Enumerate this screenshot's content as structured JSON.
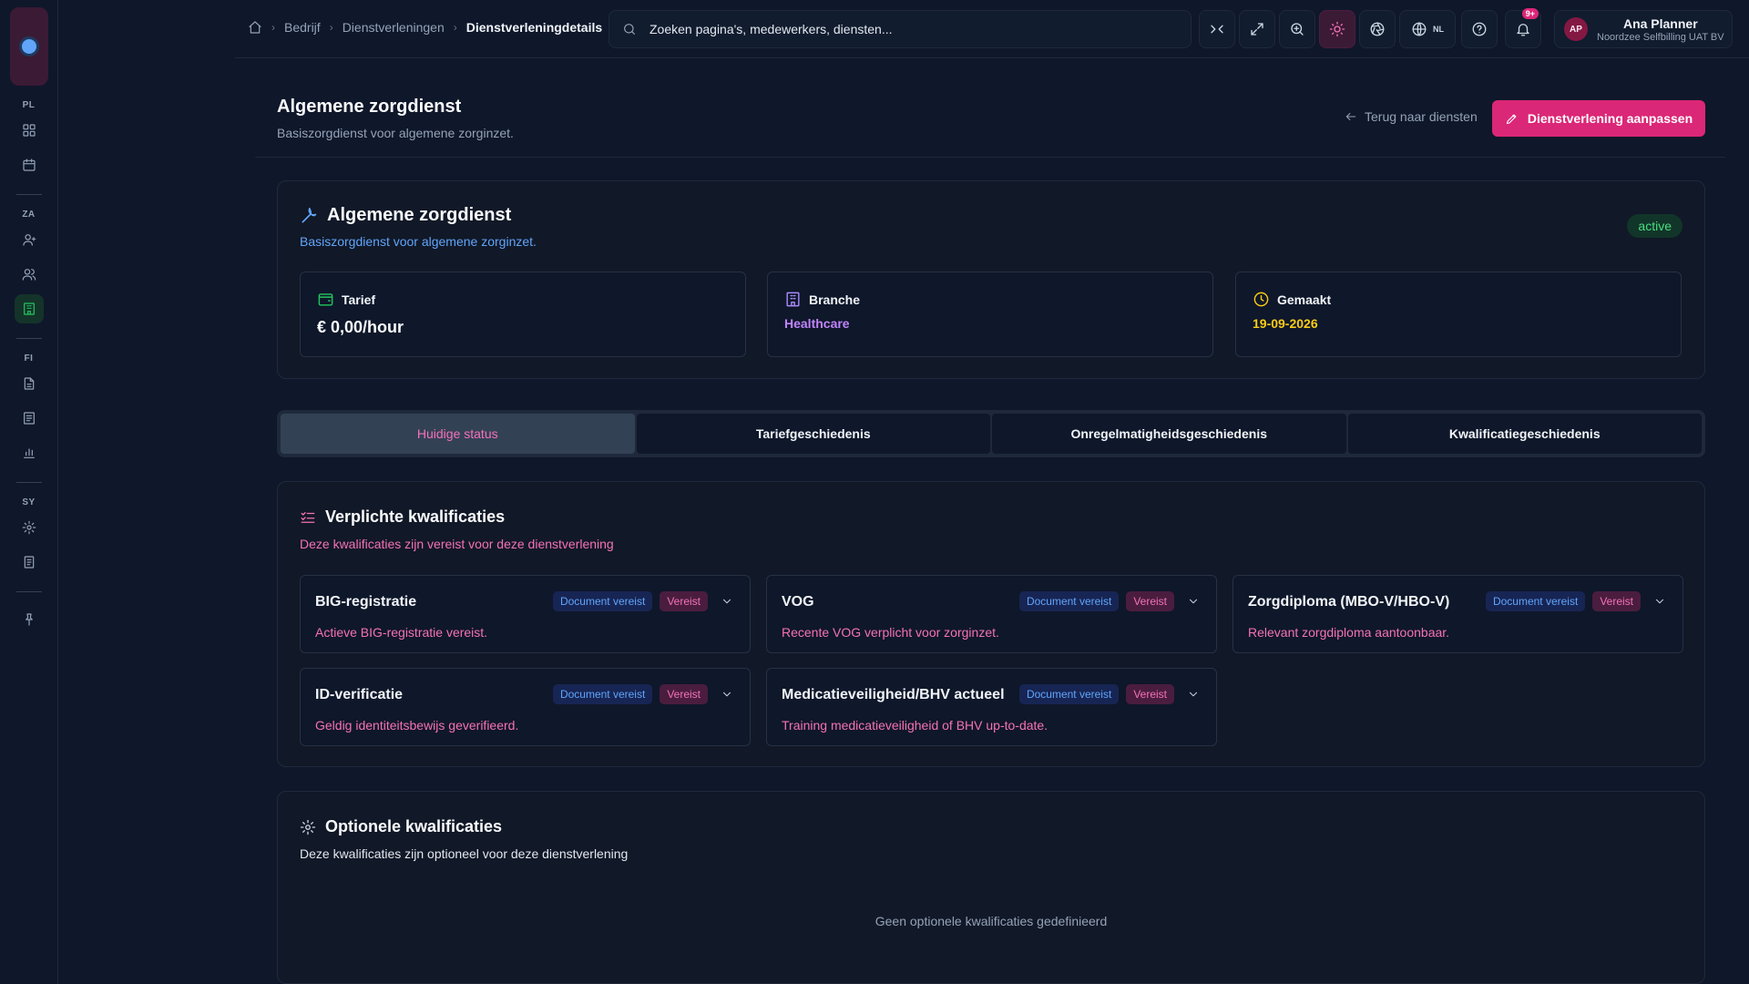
{
  "sidebar": {
    "sections": [
      {
        "label": "PL",
        "items": [
          "dashboard-icon",
          "calendar-icon"
        ]
      },
      {
        "label": "ZA",
        "items": [
          "user-icon",
          "users-icon",
          "building-icon"
        ]
      },
      {
        "label": "FI",
        "items": [
          "file-icon",
          "receipt-icon",
          "chart-icon"
        ]
      },
      {
        "label": "SY",
        "items": [
          "gear-icon",
          "document-icon"
        ]
      }
    ]
  },
  "breadcrumb": {
    "items": [
      "Bedrijf",
      "Dienstverleningen"
    ],
    "current": "Dienstverleningdetails"
  },
  "search": {
    "placeholder": "Zoeken pagina's, medewerkers, diensten..."
  },
  "toolbar": {
    "language": "NL",
    "notifications": "9+"
  },
  "user": {
    "initials": "AP",
    "name": "Ana Planner",
    "org": "Noordzee Selfbilling UAT BV"
  },
  "page": {
    "title": "Algemene zorgdienst",
    "subtitle": "Basiszorgdienst voor algemene zorginzet.",
    "back_label": "Terug naar diensten",
    "edit_label": "Dienstverlening aanpassen"
  },
  "service": {
    "title": "Algemene zorgdienst",
    "subtitle": "Basiszorgdienst voor algemene zorginzet.",
    "status": "active",
    "stats": {
      "rate": {
        "label": "Tarief",
        "value": "€ 0,00/hour"
      },
      "branch": {
        "label": "Branche",
        "value": "Healthcare"
      },
      "created": {
        "label": "Gemaakt",
        "value": "19-09-2026"
      }
    }
  },
  "tabs": [
    {
      "label": "Huidige status",
      "active": true
    },
    {
      "label": "Tariefgeschiedenis",
      "active": false
    },
    {
      "label": "Onregelmatigheidsgeschiedenis",
      "active": false
    },
    {
      "label": "Kwalificatiegeschiedenis",
      "active": false
    }
  ],
  "required": {
    "title": "Verplichte kwalificaties",
    "subtitle": "Deze kwalificaties zijn vereist voor deze dienstverlening",
    "badges": {
      "doc": "Document vereist",
      "req": "Vereist"
    },
    "items": [
      {
        "title": "BIG-registratie",
        "desc": "Actieve BIG-registratie vereist."
      },
      {
        "title": "VOG",
        "desc": "Recente VOG verplicht voor zorginzet."
      },
      {
        "title": "Zorgdiploma (MBO-V/HBO-V)",
        "desc": "Relevant zorgdiploma aantoonbaar."
      },
      {
        "title": "ID-verificatie",
        "desc": "Geldig identiteitsbewijs geverifieerd."
      },
      {
        "title": "Medicatieveiligheid/BHV actueel",
        "desc": "Training medicatieveiligheid of BHV up-to-date."
      }
    ]
  },
  "optional": {
    "title": "Optionele kwalificaties",
    "subtitle": "Deze kwalificaties zijn optioneel voor deze dienstverlening",
    "empty": "Geen optionele kwalificaties gedefinieerd"
  },
  "colors": {
    "accent": "#db2777",
    "success": "#4ade80",
    "link": "#60a5fa"
  }
}
